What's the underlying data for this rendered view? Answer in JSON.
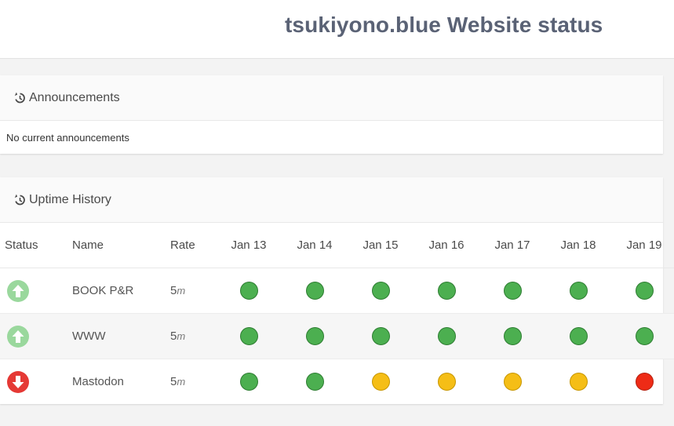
{
  "header": {
    "title": "tsukiyono.blue Website status"
  },
  "announcements": {
    "title": "Announcements",
    "icon": "history-icon",
    "message": "No current announcements"
  },
  "uptime": {
    "title": "Uptime History",
    "icon": "history-icon",
    "columns": {
      "status": "Status",
      "name": "Name",
      "rate": "Rate",
      "days": [
        "Jan 13",
        "Jan 14",
        "Jan 15",
        "Jan 16",
        "Jan 17",
        "Jan 18",
        "Jan 19"
      ]
    },
    "services": [
      {
        "status": "up",
        "name": "BOOK P&R",
        "rate_value": "5",
        "rate_unit": "m",
        "history": [
          "up",
          "up",
          "up",
          "up",
          "up",
          "up",
          "up"
        ]
      },
      {
        "status": "up",
        "name": "WWW",
        "rate_value": "5",
        "rate_unit": "m",
        "history": [
          "up",
          "up",
          "up",
          "up",
          "up",
          "up",
          "up"
        ]
      },
      {
        "status": "down",
        "name": "Mastodon",
        "rate_value": "5",
        "rate_unit": "m",
        "history": [
          "up",
          "up",
          "partial",
          "partial",
          "partial",
          "partial",
          "down"
        ]
      }
    ]
  },
  "colors": {
    "status_up": "#9ad89d",
    "status_down": "#e53935",
    "history_up": "#4caf50",
    "history_partial": "#f5be16",
    "history_down": "#ee2b16",
    "title": "#5a6275"
  }
}
